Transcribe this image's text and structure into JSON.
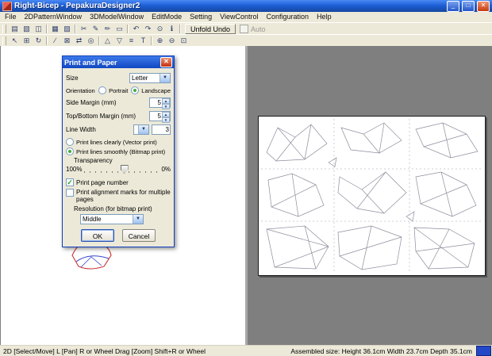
{
  "window": {
    "title": "Right-Bicep - PepakuraDesigner2"
  },
  "window_buttons": {
    "minimize": "_",
    "maximize": "□",
    "close": "✕"
  },
  "menu": {
    "items": [
      "File",
      "2DPatternWindow",
      "3DModelWindow",
      "EditMode",
      "Setting",
      "ViewControl",
      "Configuration",
      "Help"
    ]
  },
  "toolbar": {
    "row1": [
      {
        "name": "new-file-icon",
        "glyph": "▤"
      },
      {
        "name": "open-file-icon",
        "glyph": "▧"
      },
      {
        "name": "save-icon",
        "glyph": "◫"
      },
      {
        "name": "print-icon",
        "glyph": "▦"
      },
      {
        "name": "texture-icon",
        "glyph": "▨"
      },
      {
        "name": "cut-icon",
        "glyph": "✂"
      },
      {
        "name": "pen-icon",
        "glyph": "✎"
      },
      {
        "name": "pencil-icon",
        "glyph": "✏"
      },
      {
        "name": "eraser-icon",
        "glyph": "▭"
      },
      {
        "name": "undo-icon",
        "glyph": "↶"
      },
      {
        "name": "redo-icon",
        "glyph": "↷"
      },
      {
        "name": "settings-icon",
        "glyph": "⊙"
      },
      {
        "name": "info-icon",
        "glyph": "ℹ"
      }
    ],
    "unfold_undo_label": "Unfold Undo",
    "auto_label": "Auto",
    "row2": [
      {
        "name": "select-arrow-icon",
        "glyph": "↖"
      },
      {
        "name": "box-select-icon",
        "glyph": "⊞"
      },
      {
        "name": "rotate-part-icon",
        "glyph": "↻"
      },
      {
        "name": "divide-edge-icon",
        "glyph": "∕"
      },
      {
        "name": "join-edge-icon",
        "glyph": "⊠"
      },
      {
        "name": "flip-part-icon",
        "glyph": "⇄"
      },
      {
        "name": "match-face-icon",
        "glyph": "◎"
      },
      {
        "name": "add-flap-icon",
        "glyph": "△"
      },
      {
        "name": "edit-flap-icon",
        "glyph": "▽"
      },
      {
        "name": "line-style-icon",
        "glyph": "≡"
      },
      {
        "name": "text-icon",
        "glyph": "T"
      },
      {
        "name": "zoom-in-icon",
        "glyph": "⊕"
      },
      {
        "name": "zoom-out-icon",
        "glyph": "⊖"
      },
      {
        "name": "zoom-fit-icon",
        "glyph": "⊡"
      }
    ]
  },
  "icons": {
    "chevron_down": "▼",
    "spin_up": "▲",
    "spin_down": "▼",
    "check": "✓"
  },
  "dialog": {
    "title": "Print and Paper",
    "size_label": "Size",
    "size_value": "Letter",
    "orientation_label": "Orientation",
    "portrait_label": "Portrait",
    "landscape_label": "Landscape",
    "side_margin_label": "Side Margin (mm)",
    "side_margin_value": "5",
    "top_bottom_margin_label": "Top/Bottom Margin (mm)",
    "top_bottom_margin_value": "5",
    "line_width_label": "Line Width",
    "line_width_value": "3",
    "vector_option": "Print lines clearly (Vector print)",
    "bitmap_option": "Print lines smoothly (Bitmap print)",
    "transparency_label": "Transparency",
    "transparency_min": "100%",
    "transparency_max": "0%",
    "print_page_number_label": "Print page number",
    "alignment_marks_label": "Print alignment marks for multiple pages",
    "resolution_label": "Resolution (for bitmap print)",
    "resolution_value": "Middle",
    "ok_label": "OK",
    "cancel_label": "Cancel"
  },
  "statusbar": {
    "left": "2D [Select/Move] L [Pan] R or Wheel Drag [Zoom] Shift+R or Wheel",
    "right": "Assembled size: Height 36.1cm Width 23.7cm Depth 35.1cm"
  },
  "colors": {
    "titlebar_blue": "#1d5fd8",
    "pane_gray": "#7f7f7f",
    "dialog_bg": "#ece9d8",
    "selection_green": "#3fae3f"
  }
}
